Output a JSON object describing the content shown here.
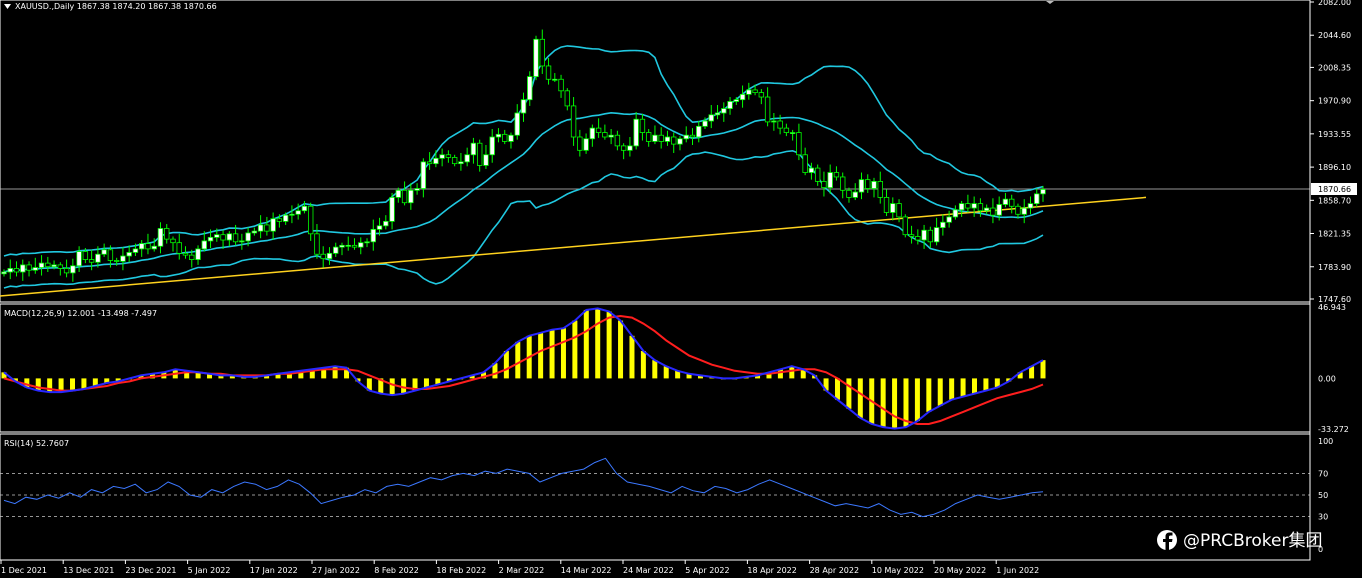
{
  "colors": {
    "background": "#000000",
    "axis": "#ffffff",
    "grid_level": "#c8c8c8",
    "bullish_candle": "#ffffff",
    "bearish_candle": "#000000",
    "candle_outline": "#00ff00",
    "bollinger": "#20c8e0",
    "trendline": "#ffd21e",
    "macd_histogram": "#ffff00",
    "macd_line": "#2828ff",
    "signal_line": "#ff1e1e",
    "rsi_line": "#3c78ff"
  },
  "header": {
    "symbol_info": "XAUUSD.,Daily  1867.38 1874.20 1867.38 1870.66"
  },
  "price_panel": {
    "ticks": [
      "2082.00",
      "2044.60",
      "2008.35",
      "1970.90",
      "1933.55",
      "1896.10",
      "1858.70",
      "1821.35",
      "1783.90",
      "1747.60"
    ],
    "current_price": "1870.66"
  },
  "macd_panel": {
    "label": "MACD(12,26,9) 12.001 -13.498 -7.497",
    "ticks": [
      "46.943",
      "0.00",
      "-33.272"
    ]
  },
  "rsi_panel": {
    "label": "RSI(14) 52.7607",
    "ticks": [
      "100",
      "70",
      "50",
      "30",
      "0"
    ]
  },
  "time_axis": [
    "1 Dec 2021",
    "13 Dec 2021",
    "23 Dec 2021",
    "5 Jan 2022",
    "17 Jan 2022",
    "27 Jan 2022",
    "8 Feb 2022",
    "18 Feb 2022",
    "2 Mar 2022",
    "14 Mar 2022",
    "24 Mar 2022",
    "5 Apr 2022",
    "18 Apr 2022",
    "28 Apr 2022",
    "10 May 2022",
    "20 May 2022",
    "1 Jun 2022"
  ],
  "watermark": {
    "icon": "facebook-icon",
    "text": "@PRCBroker集团"
  },
  "chart_data": {
    "type": "candlestick",
    "symbol": "XAUUSD.",
    "timeframe": "Daily",
    "last_bar_ohlc": [
      1867.38,
      1874.2,
      1867.38,
      1870.66
    ],
    "closes": [
      1778,
      1782,
      1778,
      1786,
      1780,
      1783,
      1788,
      1784,
      1786,
      1782,
      1777,
      1785,
      1801,
      1792,
      1789,
      1798,
      1803,
      1791,
      1790,
      1796,
      1800,
      1804,
      1810,
      1804,
      1807,
      1827,
      1815,
      1811,
      1799,
      1797,
      1792,
      1804,
      1813,
      1817,
      1820,
      1814,
      1821,
      1812,
      1813,
      1822,
      1824,
      1831,
      1824,
      1838,
      1835,
      1842,
      1843,
      1847,
      1852,
      1821,
      1798,
      1793,
      1799,
      1806,
      1808,
      1808,
      1806,
      1811,
      1812,
      1826,
      1830,
      1835,
      1862,
      1870,
      1856,
      1870,
      1872,
      1902,
      1900,
      1906,
      1910,
      1907,
      1900,
      1902,
      1910,
      1923,
      1898,
      1910,
      1930,
      1933,
      1925,
      1932,
      1957,
      1972,
      1998,
      2040,
      2010,
      1995,
      1995,
      1982,
      1965,
      1930,
      1915,
      1928,
      1940,
      1935,
      1930,
      1932,
      1920,
      1915,
      1920,
      1950,
      1935,
      1925,
      1932,
      1925,
      1930,
      1922,
      1928,
      1932,
      1930,
      1942,
      1948,
      1955,
      1957,
      1962,
      1970,
      1972,
      1978,
      1983,
      1980,
      1975,
      1947,
      1948,
      1940,
      1935,
      1935,
      1910,
      1890,
      1895,
      1880,
      1873,
      1890,
      1885,
      1870,
      1862,
      1868,
      1882,
      1872,
      1880,
      1862,
      1845,
      1855,
      1840,
      1820,
      1818,
      1814,
      1825,
      1812,
      1828,
      1834,
      1840,
      1848,
      1855,
      1850,
      1855,
      1847,
      1850,
      1842,
      1854,
      1860,
      1852,
      1843,
      1850,
      1855,
      1866,
      1871
    ],
    "bollinger_bands": {
      "upper_start": 1895,
      "upper_peak": 2060,
      "upper_end": 1880,
      "lower_start": 1760,
      "lower_trough": 1760,
      "lower_end": 1811
    },
    "trendline": {
      "from": [
        0,
        1751
      ],
      "to": [
        1,
        1862
      ]
    },
    "macd": {
      "params": [
        12,
        26,
        9
      ],
      "macd_value": 12.001,
      "signal_value": -13.498,
      "histogram_value": -7.497,
      "macd_line": [
        4,
        -2,
        -6,
        -8,
        -9,
        -9,
        -8,
        -7,
        -5,
        -3,
        -2,
        0,
        2,
        3,
        4,
        6,
        5,
        4,
        3,
        2,
        2,
        1,
        1,
        2,
        3,
        4,
        5,
        6,
        7,
        8,
        7,
        -2,
        -8,
        -10,
        -11,
        -10,
        -8,
        -6,
        -4,
        -2,
        0,
        2,
        4,
        10,
        18,
        24,
        28,
        30,
        32,
        33,
        38,
        45,
        46,
        44,
        38,
        28,
        18,
        12,
        8,
        5,
        3,
        2,
        1,
        0,
        0,
        1,
        2,
        4,
        6,
        8,
        6,
        2,
        -8,
        -14,
        -20,
        -26,
        -30,
        -32,
        -33,
        -32,
        -28,
        -22,
        -18,
        -14,
        -12,
        -10,
        -8,
        -6,
        -2,
        4,
        8,
        12
      ],
      "signal_line": [
        0,
        -2,
        -4,
        -6,
        -7,
        -8,
        -8,
        -7,
        -6,
        -5,
        -3,
        -2,
        0,
        1,
        2,
        3,
        4,
        4,
        3,
        3,
        2,
        2,
        2,
        2,
        3,
        3,
        4,
        5,
        6,
        6,
        6,
        5,
        2,
        -1,
        -4,
        -6,
        -7,
        -7,
        -6,
        -5,
        -3,
        -1,
        1,
        3,
        6,
        10,
        14,
        18,
        21,
        24,
        27,
        31,
        36,
        40,
        41,
        40,
        36,
        31,
        25,
        20,
        15,
        12,
        9,
        7,
        5,
        4,
        3,
        3,
        4,
        5,
        6,
        6,
        4,
        0,
        -5,
        -10,
        -15,
        -20,
        -25,
        -28,
        -30,
        -30,
        -28,
        -25,
        -22,
        -19,
        -16,
        -13,
        -11,
        -9,
        -7,
        -4
      ],
      "ylim": [
        -33.272,
        46.943
      ]
    },
    "rsi": {
      "period": 14,
      "last_value": 52.7607,
      "values": [
        45,
        42,
        48,
        46,
        50,
        47,
        52,
        48,
        55,
        52,
        58,
        56,
        60,
        52,
        55,
        62,
        58,
        50,
        48,
        55,
        52,
        58,
        62,
        60,
        55,
        58,
        64,
        60,
        52,
        42,
        45,
        48,
        50,
        55,
        52,
        58,
        60,
        58,
        62,
        66,
        64,
        68,
        70,
        68,
        72,
        70,
        74,
        72,
        70,
        62,
        66,
        70,
        72,
        74,
        80,
        84,
        70,
        62,
        60,
        58,
        55,
        52,
        58,
        54,
        52,
        58,
        56,
        52,
        55,
        60,
        64,
        60,
        56,
        52,
        48,
        44,
        40,
        42,
        40,
        38,
        42,
        36,
        32,
        34,
        30,
        32,
        36,
        42,
        46,
        50,
        48,
        46,
        48,
        50,
        52,
        53
      ],
      "ylim": [
        0,
        100
      ],
      "levels": [
        70,
        50,
        30
      ]
    }
  }
}
